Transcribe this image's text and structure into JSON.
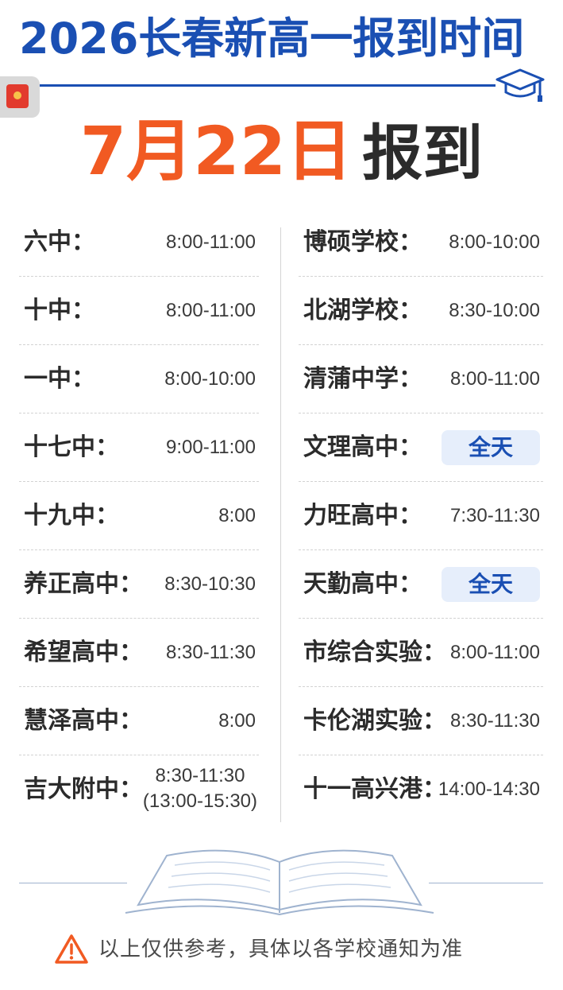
{
  "header": {
    "title": "2026长春新高一报到时间",
    "date_highlight": "7月22日",
    "date_suffix": "报到"
  },
  "left_column": [
    {
      "school": "六中：",
      "time": "8:00-11:00"
    },
    {
      "school": "十中：",
      "time": "8:00-11:00"
    },
    {
      "school": "一中：",
      "time": "8:00-10:00"
    },
    {
      "school": "十七中：",
      "time": "9:00-11:00"
    },
    {
      "school": "十九中：",
      "time": "8:00"
    },
    {
      "school": "养正高中：",
      "time": "8:30-10:30"
    },
    {
      "school": "希望高中：",
      "time": "8:30-11:30"
    },
    {
      "school": "慧泽高中：",
      "time": "8:00"
    },
    {
      "school": "吉大附中：",
      "time": "8:30-11:30",
      "time_note": "(13:00-15:30)"
    }
  ],
  "right_column": [
    {
      "school": "博硕学校：",
      "time": "8:00-10:00"
    },
    {
      "school": "北湖学校：",
      "time": "8:30-10:00"
    },
    {
      "school": "清蒲中学：",
      "time": "8:00-11:00"
    },
    {
      "school": "文理高中：",
      "badge": "全天"
    },
    {
      "school": "力旺高中：",
      "time": "7:30-11:30"
    },
    {
      "school": "天勤高中：",
      "badge": "全天"
    },
    {
      "school": "市综合实验：",
      "time": "8:00-11:00"
    },
    {
      "school": "卡伦湖实验：",
      "time": "8:30-11:30"
    },
    {
      "school": "十一高兴港：",
      "time": "14:00-14:30"
    }
  ],
  "footer": {
    "notice": "以上仅供参考，具体以各学校通知为准",
    "icon": "warning-icon"
  },
  "icons": [
    "graduation-cap-icon",
    "red-packet-icon",
    "open-book-icon",
    "warning-icon"
  ],
  "colors": {
    "title_blue": "#1a4fb3",
    "date_orange": "#f15a22",
    "badge_bg": "#e6eefb"
  }
}
